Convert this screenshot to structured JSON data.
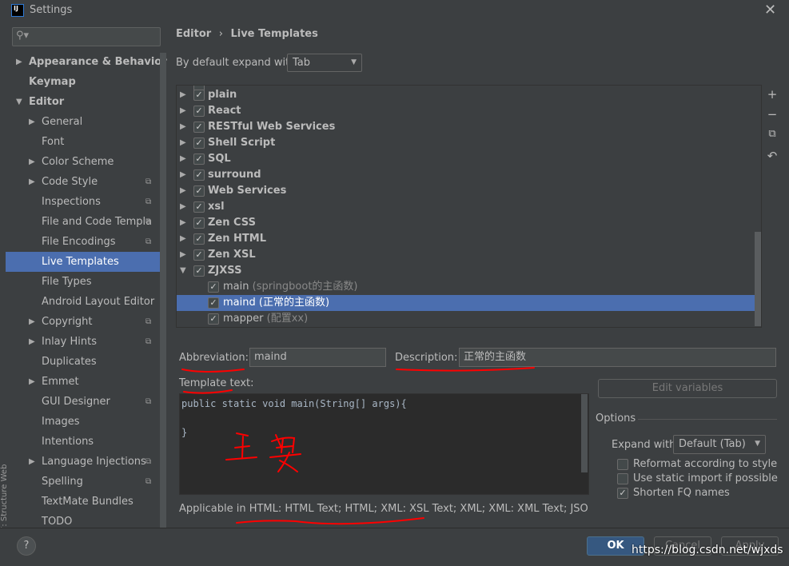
{
  "window": {
    "title": "Settings",
    "logo_text": "IJ",
    "close_icon": "close-icon"
  },
  "search": {
    "placeholder": "",
    "icon": "search-icon"
  },
  "sidebar": {
    "items": [
      {
        "label": "Appearance & Behavior",
        "level": 0,
        "bold": true,
        "arrow": "right"
      },
      {
        "label": "Keymap",
        "level": 0,
        "bold": true,
        "arrow": ""
      },
      {
        "label": "Editor",
        "level": 0,
        "bold": true,
        "arrow": "down"
      },
      {
        "label": "General",
        "level": 1,
        "arrow": "right"
      },
      {
        "label": "Font",
        "level": 1,
        "arrow": ""
      },
      {
        "label": "Color Scheme",
        "level": 1,
        "arrow": "right"
      },
      {
        "label": "Code Style",
        "level": 1,
        "arrow": "right",
        "copy": true
      },
      {
        "label": "Inspections",
        "level": 1,
        "arrow": "",
        "copy": true
      },
      {
        "label": "File and Code Templa",
        "level": 1,
        "arrow": "",
        "copy": true
      },
      {
        "label": "File Encodings",
        "level": 1,
        "arrow": "",
        "copy": true
      },
      {
        "label": "Live Templates",
        "level": 1,
        "arrow": "",
        "selected": true
      },
      {
        "label": "File Types",
        "level": 1,
        "arrow": ""
      },
      {
        "label": "Android Layout Editor",
        "level": 1,
        "arrow": ""
      },
      {
        "label": "Copyright",
        "level": 1,
        "arrow": "right",
        "copy": true
      },
      {
        "label": "Inlay Hints",
        "level": 1,
        "arrow": "right",
        "copy": true
      },
      {
        "label": "Duplicates",
        "level": 1,
        "arrow": ""
      },
      {
        "label": "Emmet",
        "level": 1,
        "arrow": "right"
      },
      {
        "label": "GUI Designer",
        "level": 1,
        "arrow": "",
        "copy": true
      },
      {
        "label": "Images",
        "level": 1,
        "arrow": ""
      },
      {
        "label": "Intentions",
        "level": 1,
        "arrow": ""
      },
      {
        "label": "Language Injections",
        "level": 1,
        "arrow": "right",
        "copy": true
      },
      {
        "label": "Spelling",
        "level": 1,
        "arrow": "",
        "copy": true
      },
      {
        "label": "TextMate Bundles",
        "level": 1,
        "arrow": ""
      },
      {
        "label": "TODO",
        "level": 1,
        "arrow": ""
      }
    ]
  },
  "breadcrumb": {
    "parent": "Editor",
    "sep": "›",
    "current": "Live Templates"
  },
  "expand": {
    "label": "By default expand with",
    "value": "Tab"
  },
  "tree": {
    "groups": [
      {
        "name": "plain",
        "checked": true
      },
      {
        "name": "React",
        "checked": true
      },
      {
        "name": "RESTful Web Services",
        "checked": true
      },
      {
        "name": "Shell Script",
        "checked": true
      },
      {
        "name": "SQL",
        "checked": true
      },
      {
        "name": "surround",
        "checked": true
      },
      {
        "name": "Web Services",
        "checked": true
      },
      {
        "name": "xsl",
        "checked": true
      },
      {
        "name": "Zen CSS",
        "checked": true
      },
      {
        "name": "Zen HTML",
        "checked": true
      },
      {
        "name": "Zen XSL",
        "checked": true
      },
      {
        "name": "ZJXSS",
        "checked": true,
        "expanded": true
      }
    ],
    "templates": [
      {
        "abbr": "main",
        "desc": "(springboot的主函数)",
        "checked": true
      },
      {
        "abbr": "maind",
        "desc": "(正常的主函数)",
        "checked": true,
        "selected": true
      },
      {
        "abbr": "mapper",
        "desc": "(配置xx)",
        "checked": true
      }
    ]
  },
  "toolbar": {
    "add": "+",
    "remove": "−",
    "copy": "⧉",
    "revert": "↶"
  },
  "abbreviation": {
    "label": "Abbreviation:",
    "value": "maind"
  },
  "description": {
    "label": "Description:",
    "value": "正常的主函数"
  },
  "template_text": {
    "label": "Template text:",
    "value": "public static void main(String[] args){\n\n}"
  },
  "edit_variables": "Edit variables",
  "options": {
    "title": "Options",
    "expand_label": "Expand with",
    "expand_value": "Default (Tab)",
    "checks": [
      {
        "label": "Reformat according to style",
        "checked": false
      },
      {
        "label": "Use static import if possible",
        "checked": false
      },
      {
        "label": "Shorten FQ names",
        "checked": true
      }
    ]
  },
  "applicable": "Applicable in HTML: HTML Text; HTML; XML: XSL Text; XML; XML: XML Text; JSON; JSON",
  "buttons": {
    "help": "?",
    "ok": "OK",
    "cancel": "Cancel",
    "apply": "Apply"
  },
  "side_tabs": [
    "Web",
    "7: Structure"
  ],
  "watermark": "https://blog.csdn.net/wjxds",
  "annotation": {
    "handwritten": "主要",
    "color": "#ff0000"
  }
}
